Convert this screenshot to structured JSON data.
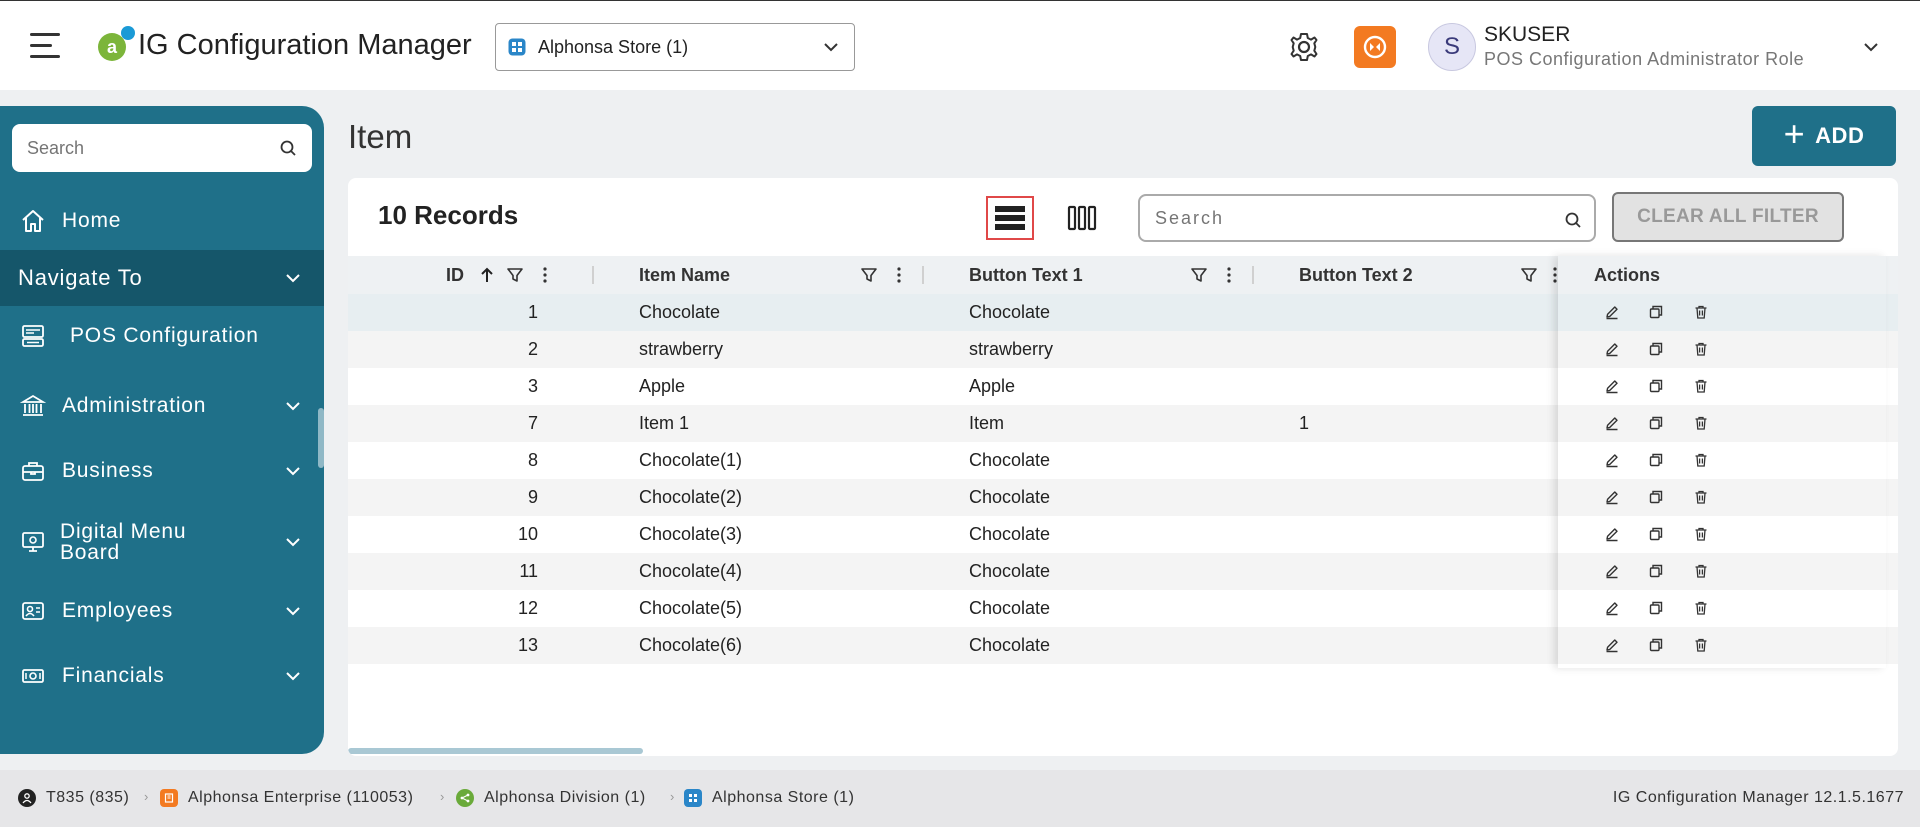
{
  "header": {
    "app_title": "IG Configuration Manager",
    "store_selector": "Alphonsa Store (1)",
    "user_initial": "S",
    "user_name": "SKUSER",
    "user_role": "POS Configuration Administrator Role"
  },
  "sidebar": {
    "search_placeholder": "Search",
    "items": [
      {
        "label": "Home",
        "icon": "home-icon"
      },
      {
        "label": "Navigate To",
        "icon": ""
      },
      {
        "label": "POS Configuration",
        "icon": "pos-terminal-icon"
      },
      {
        "label": "Administration",
        "icon": "bank-icon"
      },
      {
        "label": "Business",
        "icon": "briefcase-icon"
      },
      {
        "label": "Digital Menu Board",
        "icon": "monitor-icon"
      },
      {
        "label": "Employees",
        "icon": "id-card-icon"
      },
      {
        "label": "Financials",
        "icon": "money-icon"
      }
    ]
  },
  "main": {
    "page_title": "Item",
    "add_label": "ADD",
    "records_label": "10 Records",
    "search_placeholder": "Search",
    "clear_filter_label": "CLEAR ALL FILTER",
    "columns": {
      "id": "ID",
      "item_name": "Item Name",
      "button_text_1": "Button Text 1",
      "button_text_2": "Button Text 2",
      "actions": "Actions"
    },
    "rows": [
      {
        "id": "1",
        "name": "Chocolate",
        "bt1": "Chocolate",
        "bt2": ""
      },
      {
        "id": "2",
        "name": "strawberry",
        "bt1": "strawberry",
        "bt2": ""
      },
      {
        "id": "3",
        "name": "Apple",
        "bt1": "Apple",
        "bt2": ""
      },
      {
        "id": "7",
        "name": "Item 1",
        "bt1": "Item",
        "bt2": "1"
      },
      {
        "id": "8",
        "name": "Chocolate(1)",
        "bt1": "Chocolate",
        "bt2": ""
      },
      {
        "id": "9",
        "name": "Chocolate(2)",
        "bt1": "Chocolate",
        "bt2": ""
      },
      {
        "id": "10",
        "name": "Chocolate(3)",
        "bt1": "Chocolate",
        "bt2": ""
      },
      {
        "id": "11",
        "name": "Chocolate(4)",
        "bt1": "Chocolate",
        "bt2": ""
      },
      {
        "id": "12",
        "name": "Chocolate(5)",
        "bt1": "Chocolate",
        "bt2": ""
      },
      {
        "id": "13",
        "name": "Chocolate(6)",
        "bt1": "Chocolate",
        "bt2": ""
      }
    ]
  },
  "footer": {
    "breadcrumb": [
      "T835 (835)",
      "Alphonsa Enterprise (110053)",
      "Alphonsa Division (1)",
      "Alphonsa Store (1)"
    ],
    "version": "IG Configuration Manager 12.1.5.1677"
  },
  "colors": {
    "primary": "#1f7089",
    "primary_dark": "#15566a",
    "accent_orange": "#f37a21",
    "selected_view_border": "#e04848"
  }
}
